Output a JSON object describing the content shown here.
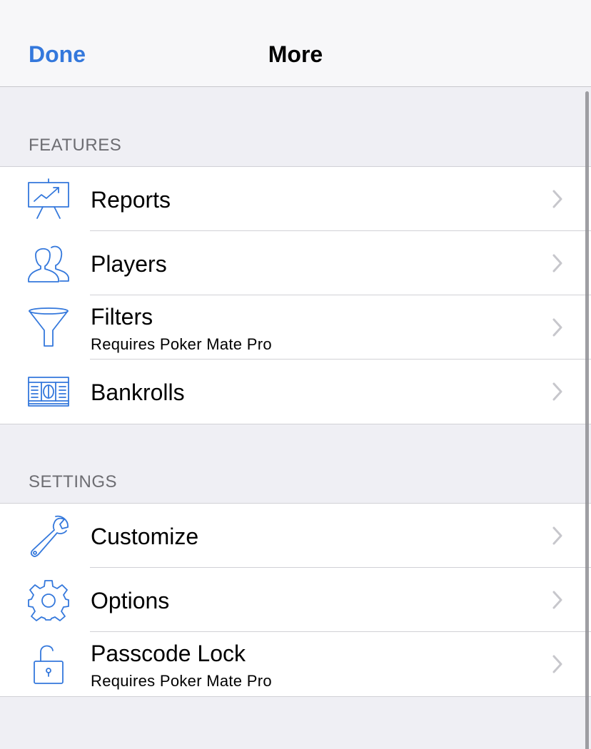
{
  "nav": {
    "done_label": "Done",
    "title": "More"
  },
  "sections": {
    "features": {
      "header": "FEATURES",
      "items": [
        {
          "label": "Reports",
          "sublabel": "",
          "icon": "presentation-chart-icon"
        },
        {
          "label": "Players",
          "sublabel": "",
          "icon": "people-icon"
        },
        {
          "label": "Filters",
          "sublabel": "Requires Poker Mate Pro",
          "icon": "funnel-icon"
        },
        {
          "label": "Bankrolls",
          "sublabel": "",
          "icon": "money-icon"
        }
      ]
    },
    "settings": {
      "header": "SETTINGS",
      "items": [
        {
          "label": "Customize",
          "sublabel": "",
          "icon": "wrench-icon"
        },
        {
          "label": "Options",
          "sublabel": "",
          "icon": "gear-icon"
        },
        {
          "label": "Passcode Lock",
          "sublabel": "Requires Poker Mate Pro",
          "icon": "lock-icon"
        }
      ]
    }
  },
  "colors": {
    "accent": "#3478dc",
    "icon": "#3478dc",
    "chevron": "#c7c7cc"
  }
}
